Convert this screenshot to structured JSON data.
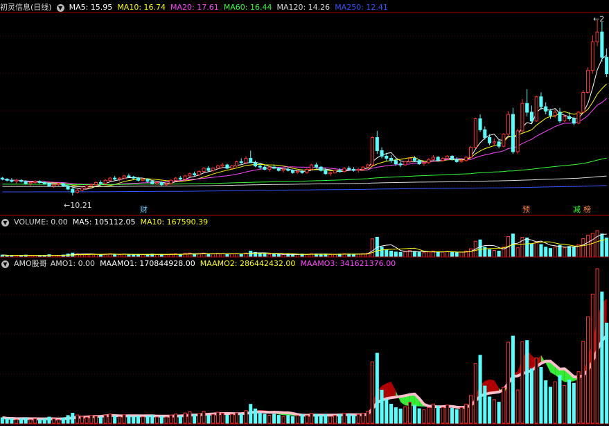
{
  "main_panel": {
    "title": "初灵信息(日线)",
    "indicators": [
      {
        "label": "MA5: 15.95",
        "color": "#ffffff"
      },
      {
        "label": "MA10: 16.74",
        "color": "#ffff00"
      },
      {
        "label": "MA20: 17.61",
        "color": "#ff44ff"
      },
      {
        "label": "MA60: 16.44",
        "color": "#33ff33"
      },
      {
        "label": "MA120: 14.26",
        "color": "#dddddd"
      },
      {
        "label": "MA250: 12.41",
        "color": "#3355ff"
      }
    ],
    "low_label": "10.21",
    "high_label": "2",
    "markers": [
      {
        "text": "财",
        "color": "#66ccff"
      },
      {
        "text": "预",
        "color": "#ff8833"
      },
      {
        "text": "减",
        "color": "#33ff33"
      },
      {
        "text": "榜",
        "color": "#ff8833"
      }
    ]
  },
  "volume_panel": {
    "title": "VOLUME: 0.00",
    "indicators": [
      {
        "label": "MA5: 105112.05",
        "color": "#ffffff"
      },
      {
        "label": "MA10: 167590.39",
        "color": "#ffff00"
      }
    ]
  },
  "amo_panel": {
    "title": "AMO股哥",
    "indicators": [
      {
        "label": "AMO1: 0.00",
        "color": "#dddddd"
      },
      {
        "label": "MAAMO1: 170844928.00",
        "color": "#ffffff"
      },
      {
        "label": "MAAMO2: 286442432.00",
        "color": "#ffff00"
      },
      {
        "label": "MAAMO3: 341621376.00",
        "color": "#ff44ff"
      }
    ]
  },
  "colors": {
    "up": "#ff3333",
    "down": "#54ffff",
    "background": "#000000",
    "separator": "#b00000"
  },
  "chart_data": {
    "type": "candlestick",
    "price_range": [
      10.21,
      20.0
    ],
    "ma_windows": [
      5,
      10,
      20,
      60,
      120,
      250
    ],
    "ohlc": [
      [
        11.8,
        11.9,
        11.6,
        11.7
      ],
      [
        11.7,
        11.8,
        11.5,
        11.6
      ],
      [
        11.6,
        11.8,
        11.4,
        11.5
      ],
      [
        11.5,
        11.7,
        11.3,
        11.6
      ],
      [
        11.6,
        11.7,
        11.4,
        11.5
      ],
      [
        11.5,
        11.6,
        11.2,
        11.3
      ],
      [
        11.3,
        11.5,
        11.1,
        11.4
      ],
      [
        11.4,
        11.6,
        11.3,
        11.5
      ],
      [
        11.5,
        11.6,
        11.3,
        11.4
      ],
      [
        11.4,
        11.5,
        11.2,
        11.3
      ],
      [
        11.3,
        11.4,
        11.0,
        11.1
      ],
      [
        11.1,
        11.3,
        10.9,
        11.2
      ],
      [
        11.2,
        11.4,
        11.1,
        11.3
      ],
      [
        11.3,
        11.4,
        11.0,
        11.1
      ],
      [
        11.1,
        11.2,
        10.7,
        10.8
      ],
      [
        10.8,
        10.9,
        10.21,
        10.5
      ],
      [
        10.5,
        10.8,
        10.4,
        10.7
      ],
      [
        10.7,
        11.0,
        10.6,
        10.9
      ],
      [
        10.9,
        11.2,
        10.8,
        11.1
      ],
      [
        11.1,
        11.3,
        11.0,
        11.2
      ],
      [
        11.2,
        11.5,
        11.1,
        11.4
      ],
      [
        11.4,
        11.6,
        11.2,
        11.3
      ],
      [
        11.3,
        11.7,
        11.2,
        11.6
      ],
      [
        11.6,
        11.9,
        11.5,
        11.8
      ],
      [
        11.8,
        12.0,
        11.6,
        11.7
      ],
      [
        11.7,
        11.9,
        11.5,
        11.8
      ],
      [
        11.8,
        12.1,
        11.7,
        12.0
      ],
      [
        12.0,
        12.2,
        11.8,
        11.9
      ],
      [
        11.9,
        12.0,
        11.7,
        11.8
      ],
      [
        11.8,
        11.9,
        11.5,
        11.6
      ],
      [
        11.6,
        11.8,
        11.5,
        11.7
      ],
      [
        11.7,
        11.8,
        11.4,
        11.5
      ],
      [
        11.5,
        11.6,
        11.2,
        11.3
      ],
      [
        11.3,
        11.5,
        11.2,
        11.4
      ],
      [
        11.4,
        11.5,
        11.1,
        11.2
      ],
      [
        11.2,
        11.4,
        11.1,
        11.3
      ],
      [
        11.3,
        11.7,
        11.2,
        11.6
      ],
      [
        11.6,
        11.9,
        11.5,
        11.8
      ],
      [
        11.8,
        12.0,
        11.6,
        11.7
      ],
      [
        11.7,
        12.1,
        11.6,
        12.0
      ],
      [
        12.0,
        12.3,
        11.9,
        12.2
      ],
      [
        12.2,
        12.4,
        12.0,
        12.1
      ],
      [
        12.1,
        12.5,
        12.0,
        12.4
      ],
      [
        12.4,
        12.8,
        12.3,
        12.7
      ],
      [
        12.7,
        12.9,
        12.4,
        12.5
      ],
      [
        12.5,
        12.8,
        12.3,
        12.7
      ],
      [
        12.7,
        13.0,
        12.6,
        12.9
      ],
      [
        12.9,
        13.2,
        12.7,
        13.0
      ],
      [
        13.0,
        13.1,
        12.6,
        12.7
      ],
      [
        12.7,
        13.0,
        12.6,
        12.9
      ],
      [
        12.9,
        13.4,
        12.8,
        13.3
      ],
      [
        13.3,
        13.6,
        13.1,
        13.2
      ],
      [
        13.2,
        13.8,
        13.1,
        13.6
      ],
      [
        13.6,
        14.3,
        13.5,
        13.2
      ],
      [
        13.2,
        13.4,
        12.8,
        12.9
      ],
      [
        12.9,
        13.1,
        12.6,
        12.8
      ],
      [
        12.8,
        13.0,
        12.5,
        12.6
      ],
      [
        12.6,
        12.9,
        12.4,
        12.8
      ],
      [
        12.8,
        13.0,
        12.6,
        12.7
      ],
      [
        12.7,
        12.8,
        12.4,
        12.5
      ],
      [
        12.5,
        12.7,
        12.3,
        12.6
      ],
      [
        12.6,
        12.8,
        12.4,
        12.5
      ],
      [
        12.5,
        12.6,
        12.2,
        12.3
      ],
      [
        12.3,
        12.5,
        12.2,
        12.4
      ],
      [
        12.4,
        12.6,
        12.2,
        12.3
      ],
      [
        12.3,
        12.7,
        12.2,
        12.6
      ],
      [
        12.6,
        13.1,
        12.5,
        13.0
      ],
      [
        13.0,
        13.2,
        12.7,
        12.8
      ],
      [
        12.8,
        12.9,
        12.4,
        12.5
      ],
      [
        12.5,
        12.7,
        12.1,
        12.2
      ],
      [
        12.2,
        12.4,
        12.0,
        12.3
      ],
      [
        12.3,
        12.6,
        12.2,
        12.5
      ],
      [
        12.5,
        12.7,
        12.3,
        12.4
      ],
      [
        12.4,
        12.8,
        12.3,
        12.7
      ],
      [
        12.7,
        12.9,
        12.5,
        12.6
      ],
      [
        12.6,
        12.8,
        12.4,
        12.5
      ],
      [
        12.5,
        12.7,
        12.3,
        12.6
      ],
      [
        12.6,
        12.9,
        12.5,
        12.8
      ],
      [
        12.8,
        13.1,
        12.7,
        13.0
      ],
      [
        13.0,
        15.6,
        12.9,
        15.5
      ],
      [
        15.5,
        16.1,
        14.0,
        14.3
      ],
      [
        14.3,
        14.6,
        13.6,
        13.8
      ],
      [
        13.8,
        14.1,
        13.3,
        13.6
      ],
      [
        13.6,
        13.9,
        13.2,
        13.4
      ],
      [
        13.4,
        13.6,
        12.9,
        13.1
      ],
      [
        13.1,
        13.3,
        12.8,
        13.0
      ],
      [
        13.0,
        13.4,
        12.9,
        13.3
      ],
      [
        13.3,
        13.7,
        13.2,
        13.6
      ],
      [
        13.6,
        13.8,
        13.3,
        13.4
      ],
      [
        13.4,
        13.5,
        13.0,
        13.1
      ],
      [
        13.1,
        13.3,
        12.9,
        13.2
      ],
      [
        13.2,
        13.6,
        13.1,
        13.5
      ],
      [
        13.5,
        13.9,
        13.4,
        13.7
      ],
      [
        13.7,
        13.8,
        13.3,
        13.4
      ],
      [
        13.4,
        13.7,
        13.3,
        13.6
      ],
      [
        13.6,
        13.9,
        13.5,
        13.8
      ],
      [
        13.8,
        13.9,
        13.4,
        13.5
      ],
      [
        13.5,
        13.7,
        13.2,
        13.3
      ],
      [
        13.3,
        13.5,
        13.2,
        13.4
      ],
      [
        13.4,
        13.8,
        13.3,
        13.7
      ],
      [
        13.7,
        14.7,
        13.6,
        14.6
      ],
      [
        14.6,
        17.3,
        14.5,
        17.2
      ],
      [
        17.2,
        17.6,
        16.0,
        16.2
      ],
      [
        16.2,
        16.5,
        15.3,
        15.5
      ],
      [
        15.5,
        15.8,
        14.8,
        15.0
      ],
      [
        15.0,
        15.4,
        14.7,
        15.1
      ],
      [
        15.1,
        15.3,
        14.5,
        14.7
      ],
      [
        14.7,
        15.9,
        14.6,
        15.8
      ],
      [
        15.8,
        17.9,
        15.6,
        17.6
      ],
      [
        17.6,
        18.2,
        14.0,
        14.2
      ],
      [
        14.2,
        16.3,
        14.0,
        16.1
      ],
      [
        16.1,
        19.0,
        15.9,
        18.6
      ],
      [
        18.6,
        19.9,
        17.4,
        17.8
      ],
      [
        17.8,
        18.4,
        16.8,
        17.0
      ],
      [
        17.0,
        19.3,
        16.9,
        19.2
      ],
      [
        19.2,
        19.6,
        18.0,
        18.3
      ],
      [
        18.3,
        18.7,
        17.6,
        17.9
      ],
      [
        17.9,
        18.1,
        17.2,
        17.5
      ],
      [
        17.5,
        18.0,
        17.3,
        17.8
      ],
      [
        17.8,
        18.2,
        16.8,
        17.0
      ],
      [
        17.0,
        17.6,
        16.9,
        17.4
      ],
      [
        17.4,
        17.8,
        17.0,
        17.2
      ],
      [
        17.2,
        17.4,
        16.6,
        16.8
      ],
      [
        16.8,
        17.9,
        16.7,
        17.8
      ],
      [
        17.8,
        19.8,
        17.7,
        19.6
      ],
      [
        19.6,
        21.9,
        19.5,
        21.6
      ],
      [
        21.6,
        24.8,
        21.3,
        24.2
      ],
      [
        24.2,
        26.2,
        23.8,
        25.1
      ],
      [
        25.1,
        26.0,
        22.4,
        22.8
      ],
      [
        22.8,
        23.6,
        21.0,
        21.3
      ]
    ],
    "volume": [
      6,
      5,
      5,
      4,
      5,
      6,
      4,
      5,
      4,
      5,
      7,
      5,
      4,
      6,
      9,
      12,
      10,
      8,
      7,
      9,
      8,
      7,
      9,
      10,
      8,
      7,
      9,
      8,
      7,
      8,
      7,
      8,
      9,
      7,
      8,
      7,
      9,
      10,
      8,
      11,
      12,
      9,
      10,
      12,
      8,
      9,
      11,
      10,
      8,
      9,
      10,
      9,
      12,
      18,
      14,
      10,
      9,
      8,
      9,
      8,
      7,
      8,
      7,
      8,
      9,
      8,
      10,
      9,
      8,
      9,
      7,
      8,
      9,
      10,
      9,
      8,
      9,
      10,
      12,
      55,
      60,
      30,
      22,
      18,
      15,
      14,
      16,
      20,
      17,
      14,
      13,
      15,
      18,
      16,
      15,
      17,
      14,
      13,
      15,
      18,
      25,
      48,
      52,
      30,
      22,
      20,
      18,
      30,
      62,
      70,
      28,
      60,
      58,
      40,
      46,
      38,
      30,
      26,
      30,
      35,
      28,
      32,
      30,
      38,
      56,
      66,
      72,
      80,
      70,
      58
    ]
  }
}
